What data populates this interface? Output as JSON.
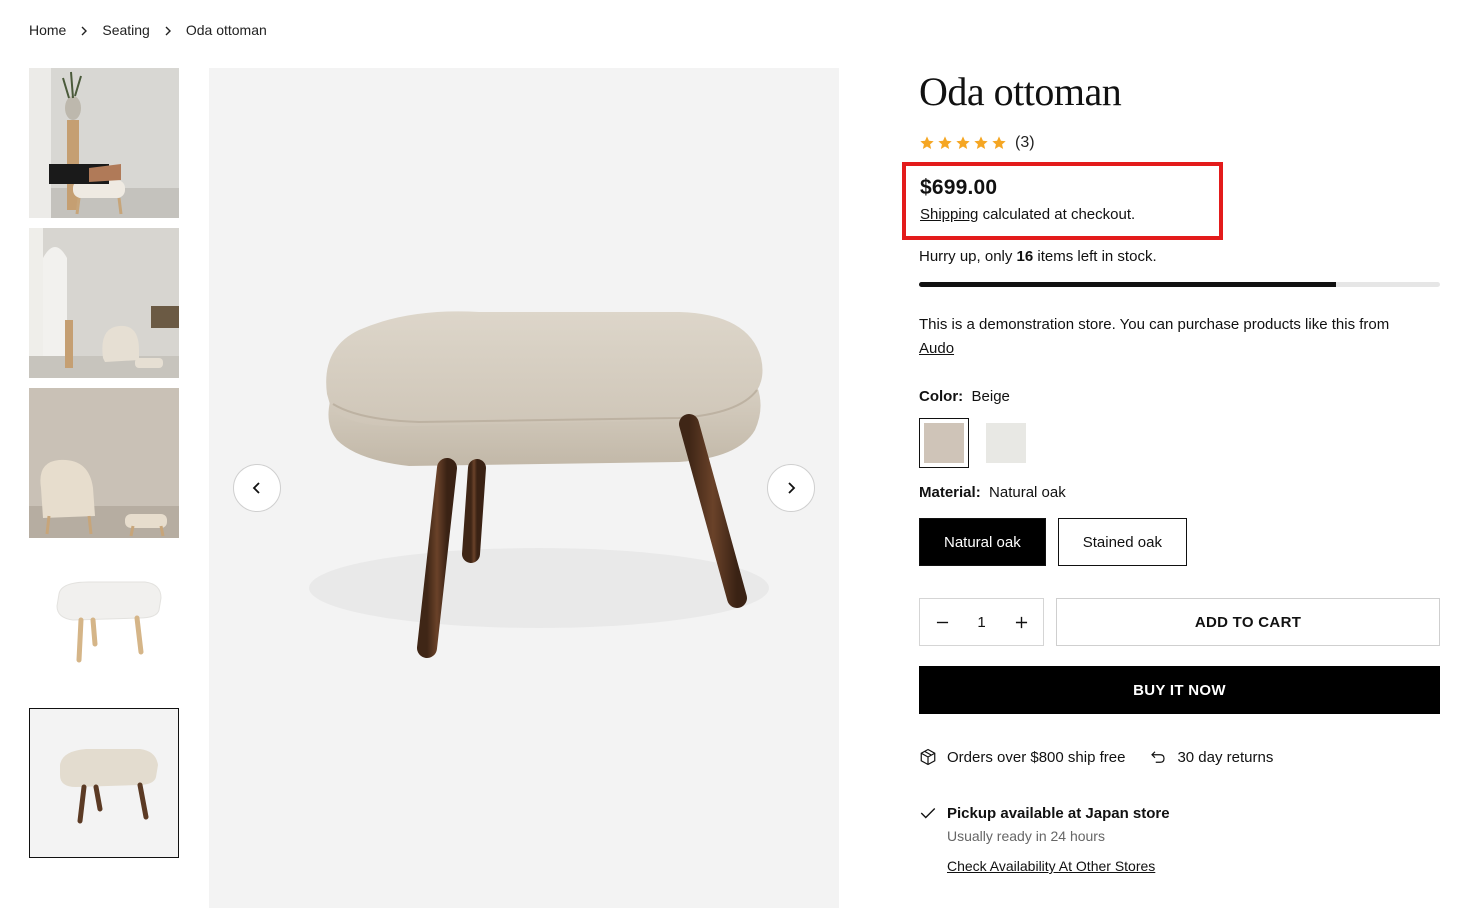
{
  "breadcrumb": {
    "items": [
      "Home",
      "Seating",
      "Oda ottoman"
    ]
  },
  "gallery": {
    "thumbnails": [
      "lifestyle-feet-on-ottoman",
      "lifestyle-room-chair-ottoman",
      "lifestyle-chair-and-ottoman",
      "ottoman-white-natural-oak",
      "ottoman-beige-stained-oak"
    ],
    "active_index": 4,
    "prev_icon": "chevron-left-icon",
    "next_icon": "chevron-right-icon"
  },
  "product": {
    "title": "Oda ottoman",
    "rating": 5,
    "review_count": "(3)",
    "star_color": "#f5a623",
    "price": "$699.00",
    "shipping_link": "Shipping",
    "shipping_text": "calculated at checkout.",
    "stock_prefix": "Hurry up, only",
    "stock_count": "16",
    "stock_suffix": "items left in stock.",
    "stock_level": 0.8,
    "demo_text": "This is a demonstration store. You can purchase products like this from",
    "demo_link": "Audo"
  },
  "options": {
    "color_label": "Color:",
    "color_value": "Beige",
    "colors": [
      {
        "name": "Beige",
        "hex": "#cfc4b8",
        "selected": true
      },
      {
        "name": "White",
        "hex": "#e8e8e4",
        "selected": false
      }
    ],
    "material_label": "Material:",
    "material_value": "Natural oak",
    "materials": [
      {
        "label": "Natural oak",
        "selected": true
      },
      {
        "label": "Stained oak",
        "selected": false
      }
    ]
  },
  "cart": {
    "quantity": "1",
    "add_to_cart": "ADD TO CART",
    "buy_now": "BUY IT NOW"
  },
  "perks": {
    "shipping": "Orders over $800 ship free",
    "returns": "30 day returns"
  },
  "pickup": {
    "title": "Pickup available at Japan store",
    "subtitle": "Usually ready in 24 hours",
    "link": "Check Availability At Other Stores"
  },
  "highlight_color": "#e31b1b"
}
